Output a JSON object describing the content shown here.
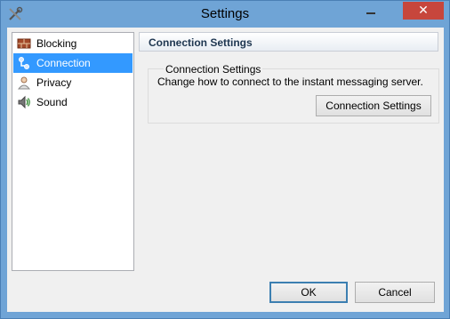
{
  "window": {
    "title": "Settings",
    "close_glyph": "✕"
  },
  "nav": {
    "items": [
      {
        "label": "Blocking",
        "icon": "blocking-brick-icon"
      },
      {
        "label": "Connection",
        "icon": "connection-icon",
        "selected": true
      },
      {
        "label": "Privacy",
        "icon": "user-privacy-icon"
      },
      {
        "label": "Sound",
        "icon": "speaker-icon"
      }
    ]
  },
  "panel": {
    "header": "Connection Settings",
    "group_title": "Connection Settings",
    "description": "Change how to connect to the instant messaging server.",
    "button": "Connection Settings"
  },
  "footer": {
    "ok": "OK",
    "cancel": "Cancel"
  },
  "colors": {
    "selection": "#3399ff",
    "close": "#c7463c",
    "frame": "#6fa4d6"
  }
}
